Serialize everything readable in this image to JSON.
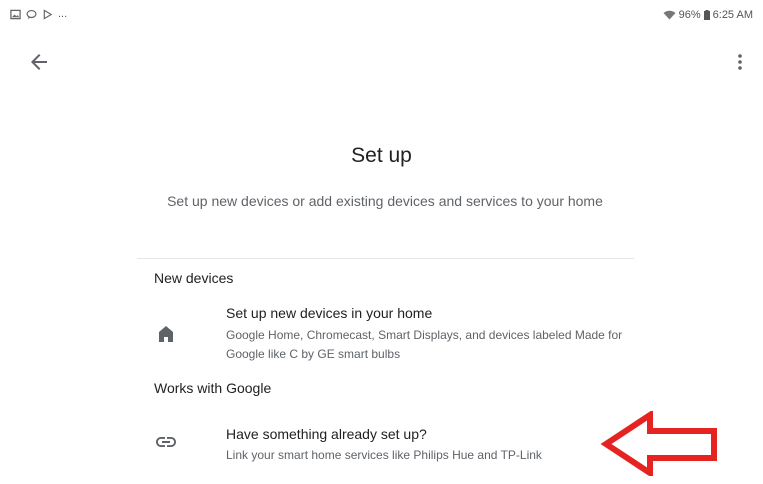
{
  "status_bar": {
    "left_icons": [
      "image-icon",
      "chat-icon",
      "play-store-icon"
    ],
    "overflow": "...",
    "battery": "96%",
    "time": "6:25 AM"
  },
  "toolbar": {
    "back_icon": "arrow-back-icon",
    "more_icon": "more-vert-icon"
  },
  "page": {
    "title": "Set up",
    "subtitle": "Set up new devices or add existing devices and services to your home"
  },
  "sections": {
    "new_devices": {
      "header": "New devices",
      "item": {
        "icon": "home-icon",
        "title": "Set up new devices in your home",
        "subtitle": "Google Home, Chromecast, Smart Displays, and devices labeled Made for Google like C by GE smart bulbs"
      }
    },
    "works_with_google": {
      "header": "Works with Google",
      "item": {
        "icon": "link-icon",
        "title": "Have something already set up?",
        "subtitle": "Link your smart home services like Philips Hue and TP-Link"
      }
    }
  },
  "annotation": {
    "icon": "red-arrow-icon",
    "color": "#e52421"
  }
}
